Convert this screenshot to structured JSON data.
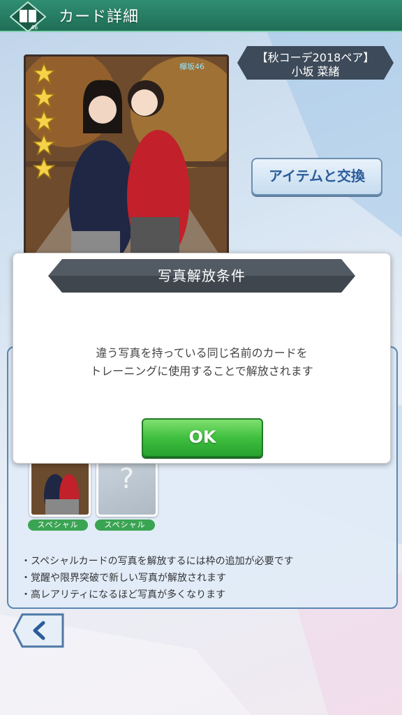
{
  "header": {
    "title": "カード詳細",
    "emblem_number": "46",
    "emblem_icon": "book-icon",
    "color": "#2f8e72"
  },
  "card": {
    "stars": 5,
    "star_icon": "star-icon",
    "logo_text": "欅坂46"
  },
  "name_banner": {
    "line1": "【秋コーデ2018ペア】",
    "line2": "小坂 菜緒"
  },
  "exchange_button": {
    "label": "アイテムと交換"
  },
  "panel": {
    "thumbs": [
      {
        "badge": "スペシャル",
        "locked": false
      },
      {
        "badge": "スペシャル",
        "locked": true,
        "icon": "question-icon"
      }
    ],
    "notes": [
      "・スペシャルカードの写真を解放するには枠の追加が必要です",
      "・覚醒や限界突破で新しい写真が解放されます",
      "・高レアリティになるほど写真が多くなります"
    ]
  },
  "back_button": {
    "icon": "chevron-left-icon"
  },
  "dialog": {
    "title": "写真解放条件",
    "message_line1": "違う写真を持っている同じ名前のカードを",
    "message_line2": "トレーニングに使用することで解放されます",
    "ok_label": "OK",
    "ok_color": "#3fbf3f"
  }
}
